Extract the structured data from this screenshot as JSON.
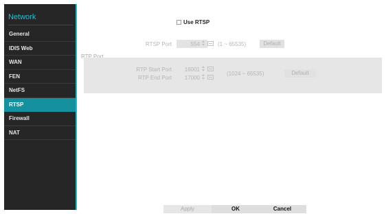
{
  "sidebar": {
    "title": "Network",
    "items": [
      {
        "label": "General"
      },
      {
        "label": "IDIS Web"
      },
      {
        "label": "WAN"
      },
      {
        "label": "FEN"
      },
      {
        "label": "NetFS"
      },
      {
        "label": "RTSP",
        "active": true
      },
      {
        "label": "Firewall"
      },
      {
        "label": "NAT"
      }
    ]
  },
  "rtsp": {
    "use_rtsp_label": "Use RTSP",
    "use_rtsp_checked": false,
    "rtsp_port_label": "RTSP Port",
    "rtsp_port_value": "554",
    "rtsp_port_range": "(1 ~ 65535)",
    "rtsp_default_label": "Default"
  },
  "rtp": {
    "section_label": "RTP Port",
    "start_label": "RTP Start Port",
    "start_value": "16001",
    "end_label": "RTP End Port",
    "end_value": "17000",
    "range": "(1024 ~ 65535)",
    "default_label": "Default"
  },
  "buttons": {
    "apply": "Apply",
    "ok": "OK",
    "cancel": "Cancel"
  },
  "colors": {
    "accent": "#24c2d4",
    "active_item": "#15909f",
    "sidebar_bg": "#262626"
  },
  "icons": {
    "spinner": "spin-updown-icon",
    "keyboard": "keyboard-icon"
  }
}
